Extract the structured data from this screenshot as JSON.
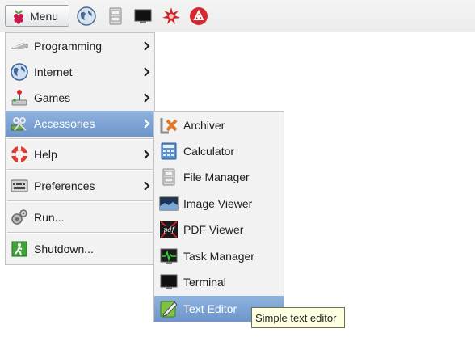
{
  "taskbar": {
    "menu_label": "Menu",
    "icons": [
      "raspberry-icon",
      "web-browser-icon",
      "file-manager-icon",
      "terminal-icon",
      "burst-icon",
      "wolfram-icon"
    ]
  },
  "main_menu": {
    "items": [
      {
        "label": "Programming",
        "icon": "programming-icon",
        "has_submenu": true
      },
      {
        "label": "Internet",
        "icon": "internet-icon",
        "has_submenu": true
      },
      {
        "label": "Games",
        "icon": "games-icon",
        "has_submenu": true
      },
      {
        "label": "Accessories",
        "icon": "accessories-icon",
        "has_submenu": true,
        "active": true
      },
      {
        "label": "Help",
        "icon": "help-icon",
        "has_submenu": true
      },
      {
        "label": "Preferences",
        "icon": "preferences-icon",
        "has_submenu": true
      },
      {
        "label": "Run...",
        "icon": "run-icon",
        "has_submenu": false
      },
      {
        "label": "Shutdown...",
        "icon": "shutdown-icon",
        "has_submenu": false
      }
    ]
  },
  "accessories_menu": {
    "items": [
      {
        "label": "Archiver",
        "icon": "archiver-icon"
      },
      {
        "label": "Calculator",
        "icon": "calculator-icon"
      },
      {
        "label": "File Manager",
        "icon": "file-manager-icon"
      },
      {
        "label": "Image Viewer",
        "icon": "image-viewer-icon"
      },
      {
        "label": "PDF Viewer",
        "icon": "pdf-viewer-icon"
      },
      {
        "label": "Task Manager",
        "icon": "task-manager-icon"
      },
      {
        "label": "Terminal",
        "icon": "terminal-icon"
      },
      {
        "label": "Text Editor",
        "icon": "text-editor-icon",
        "active": true
      }
    ]
  },
  "tooltip": {
    "text": "Simple text editor"
  },
  "colors": {
    "highlight": "#7ea4d6",
    "menu_bg": "#f2f2f2",
    "tooltip_bg": "#ffffe1",
    "raspberry": "#c51a4a"
  }
}
